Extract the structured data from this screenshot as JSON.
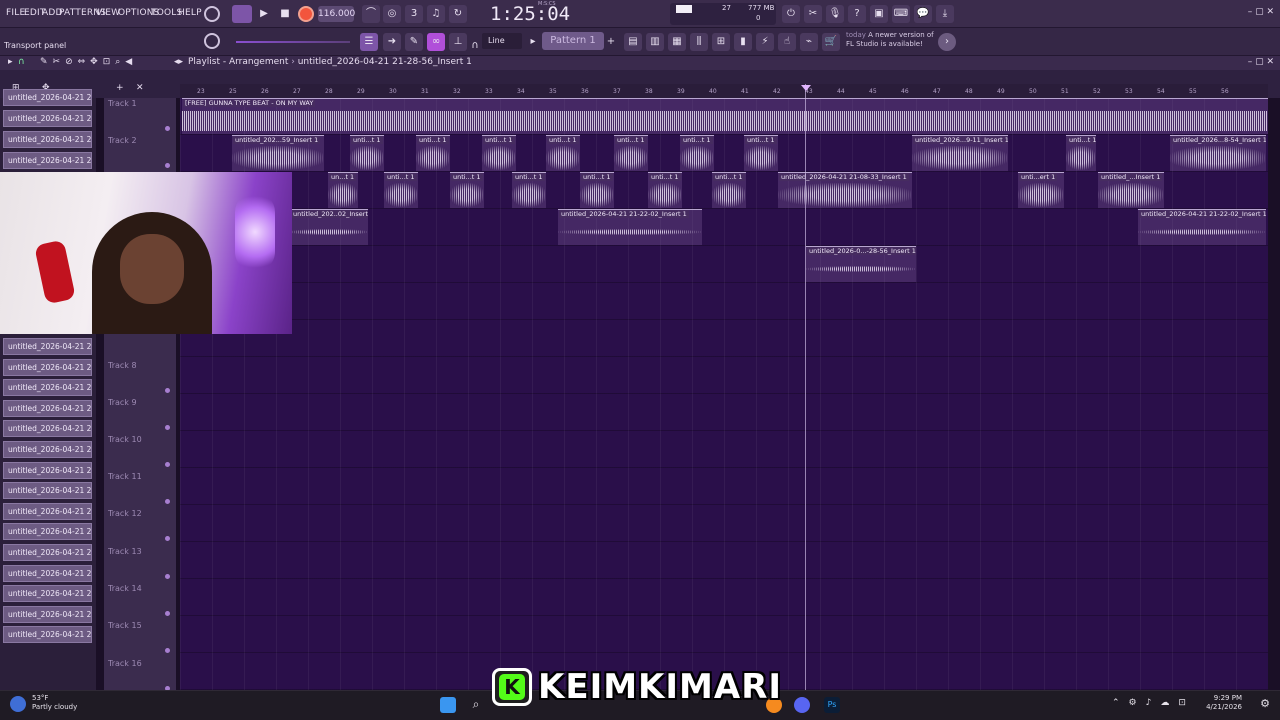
{
  "menu": [
    "FILE",
    "EDIT",
    "ADD",
    "PATTERNS",
    "VIEW",
    "OPTIONS",
    "TOOLS",
    "HELP"
  ],
  "transport": {
    "tempo": "116.000",
    "time": "1:25:04",
    "time_unit": "M:S:CS",
    "cpu": "27",
    "memory": "777 MB",
    "memory_sub": "0"
  },
  "toolbar": {
    "panel_label": "Transport panel",
    "snap_mode": "Line",
    "pattern": "Pattern 1",
    "news_today": "today",
    "news_text": "A newer version of FL Studio is available!"
  },
  "playlist": {
    "title": "Playlist - Arrangement",
    "breadcrumb": "untitled_2026-04-21 21-28-56_Insert 1",
    "ruler": [
      "23",
      "25",
      "26",
      "27",
      "28",
      "29",
      "30",
      "31",
      "32",
      "33",
      "34",
      "35",
      "36",
      "37",
      "38",
      "39",
      "40",
      "41",
      "42",
      "43",
      "44",
      "45",
      "46",
      "47",
      "48",
      "49",
      "50",
      "51",
      "52",
      "53",
      "54",
      "55",
      "56"
    ]
  },
  "clip_list": [
    "untitled_2026-04-21 21-...",
    "untitled_2026-04-21 21-...",
    "untitled_2026-04-21 21-...",
    "untitled_2026-04-21 21-...",
    "untitled_2026-04-21 21-...",
    "untitled_2026-04-21 21-...",
    "untitled_2026-04-21 21-...",
    "untitled_2026-04-21 21-...",
    "untitled_2026-04-21 21-...",
    "untitled_2026-04-21 21-...",
    "untitled_2026-04-21 21-...",
    "untitled_2026-04-21 21-...",
    "untitled_2026-04-21 21-...",
    "untitled_2026-04-21 21-...",
    "untitled_2026-04-21 21-...",
    "untitled_2026-04-21 21-...",
    "untitled_2026-04-21 21-...",
    "untitled_2026-04-21 21-...",
    "untitled_2026-04-21 21-..."
  ],
  "tracks": [
    "Track 1",
    "Track 2",
    "Track 8",
    "Track 9",
    "Track 10",
    "Track 11",
    "Track 12",
    "Track 13",
    "Track 14",
    "Track 15",
    "Track 16"
  ],
  "clips": {
    "beat": "[FREE] GUNNA TYPE BEAT - ON MY WAY",
    "t2_a": "untitled_202...59_Insert 1",
    "t2_b": "unti...t 1",
    "t2_c": "untitled_2026...9-11_Insert 1",
    "t2_d": "unti...t 1",
    "t2_e": "untitled_2026...8-54_Insert 1",
    "t3_a": "un...t 1",
    "t3_b": "untitled_2026-04-21 21-08-33_Insert 1",
    "t3_c": "unti...ert 1",
    "t3_d": "untitled_...Insert 1",
    "t4_a": "untitled_202..02_Insert 1",
    "t4_b": "untitled_2026-04-21 21-22-02_Insert 1",
    "t4_c": "untitled_2026-04-21 21-22-02_Insert 1",
    "t5_a": "untitled_2026-0...-28-56_Insert 1"
  },
  "taskbar": {
    "weather_temp": "53°F",
    "weather_desc": "Partly cloudy",
    "time": "9:29 PM",
    "date": "4/21/2026"
  },
  "brand": {
    "logo_letter": "K",
    "name": "KEIMKIMARI"
  },
  "colors": {
    "accent": "#53fc18",
    "grid": "#2a0f4a",
    "record": "#f2553d"
  }
}
